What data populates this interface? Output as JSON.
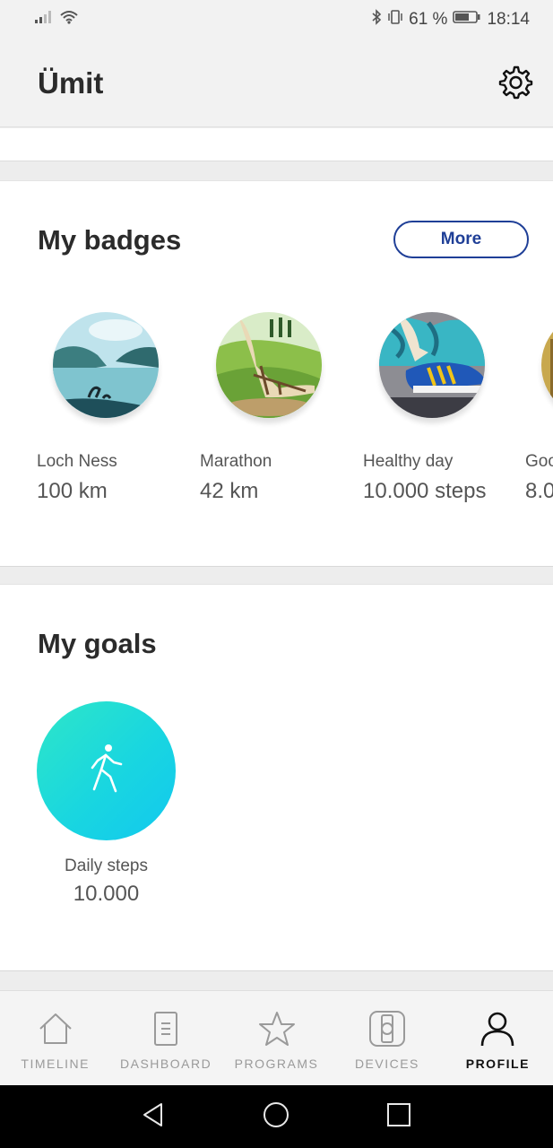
{
  "status": {
    "battery_percent": "61 %",
    "time": "18:14"
  },
  "header": {
    "title": "Ümit"
  },
  "badges": {
    "title": "My badges",
    "more_label": "More",
    "items": [
      {
        "name": "Loch Ness",
        "value": "100 km",
        "icon": "loch-ness-badge"
      },
      {
        "name": "Marathon",
        "value": "42 km",
        "icon": "marathon-badge"
      },
      {
        "name": "Healthy day",
        "value": "10.000 steps",
        "icon": "healthy-day-badge"
      },
      {
        "name": "Goo",
        "value": "8.0",
        "icon": "partial-badge"
      }
    ]
  },
  "goals": {
    "title": "My goals",
    "items": [
      {
        "name": "Daily steps",
        "value": "10.000",
        "icon": "walking-person-icon"
      }
    ]
  },
  "nav": {
    "items": [
      {
        "label": "TIMELINE",
        "icon": "home-icon",
        "active": false
      },
      {
        "label": "DASHBOARD",
        "icon": "dashboard-icon",
        "active": false
      },
      {
        "label": "PROGRAMS",
        "icon": "star-icon",
        "active": false
      },
      {
        "label": "DEVICES",
        "icon": "watch-icon",
        "active": false
      },
      {
        "label": "PROFILE",
        "icon": "person-icon",
        "active": true
      }
    ]
  },
  "colors": {
    "accent": "#1f3f97",
    "goal_gradient_start": "#2ee6c8",
    "goal_gradient_end": "#12c8ef"
  }
}
